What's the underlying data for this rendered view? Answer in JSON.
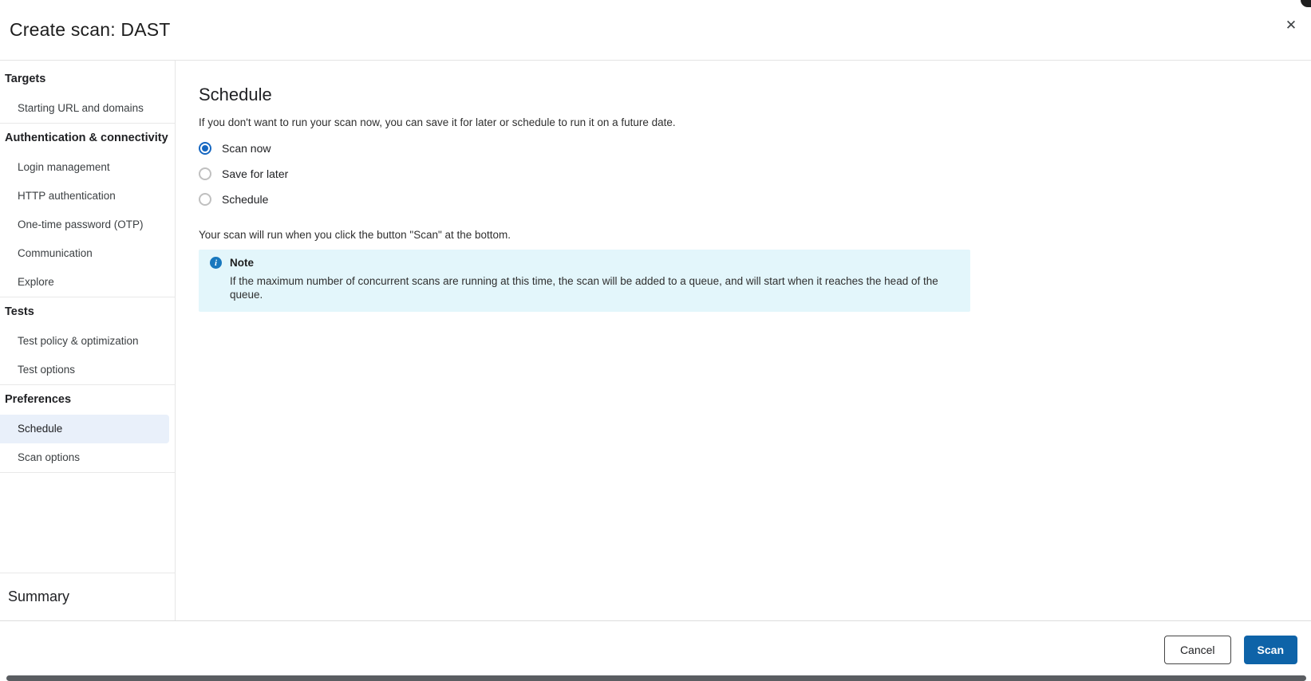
{
  "dialog": {
    "title": "Create scan: DAST",
    "close_icon": "✕"
  },
  "sidebar": {
    "sections": [
      {
        "label": "Targets",
        "items": [
          {
            "label": "Starting URL and domains",
            "selected": false
          }
        ]
      },
      {
        "label": "Authentication & connectivity",
        "items": [
          {
            "label": "Login management",
            "selected": false
          },
          {
            "label": "HTTP authentication",
            "selected": false
          },
          {
            "label": "One-time password (OTP)",
            "selected": false
          },
          {
            "label": "Communication",
            "selected": false
          },
          {
            "label": "Explore",
            "selected": false
          }
        ]
      },
      {
        "label": "Tests",
        "items": [
          {
            "label": "Test policy & optimization",
            "selected": false
          },
          {
            "label": "Test options",
            "selected": false
          }
        ]
      },
      {
        "label": "Preferences",
        "items": [
          {
            "label": "Schedule",
            "selected": true
          },
          {
            "label": "Scan options",
            "selected": false
          }
        ]
      }
    ],
    "summary_label": "Summary"
  },
  "main": {
    "heading": "Schedule",
    "intro": "If you don't want to run your scan now, you can save it for later or schedule to run it on a future date.",
    "radio_options": [
      {
        "label": "Scan now",
        "selected": true
      },
      {
        "label": "Save for later",
        "selected": false
      },
      {
        "label": "Schedule",
        "selected": false
      }
    ],
    "run_info": "Your scan will run when you click the button \"Scan\" at the bottom.",
    "note": {
      "icon": "info-icon",
      "title": "Note",
      "body": "If the maximum number of concurrent scans are running at this time, the scan will be added to a queue, and will start when it reaches the head of the queue."
    }
  },
  "footer": {
    "cancel_label": "Cancel",
    "scan_label": "Scan"
  },
  "colors": {
    "accent": "#0e63a8",
    "radio-blue": "#1667c1",
    "note-bg": "#e3f6fb",
    "note-icon": "#1878be",
    "sidebar-selected": "#e9f0fa",
    "divider": "#e4e4e4",
    "scrollbar-thumb": "#5a5d61"
  }
}
